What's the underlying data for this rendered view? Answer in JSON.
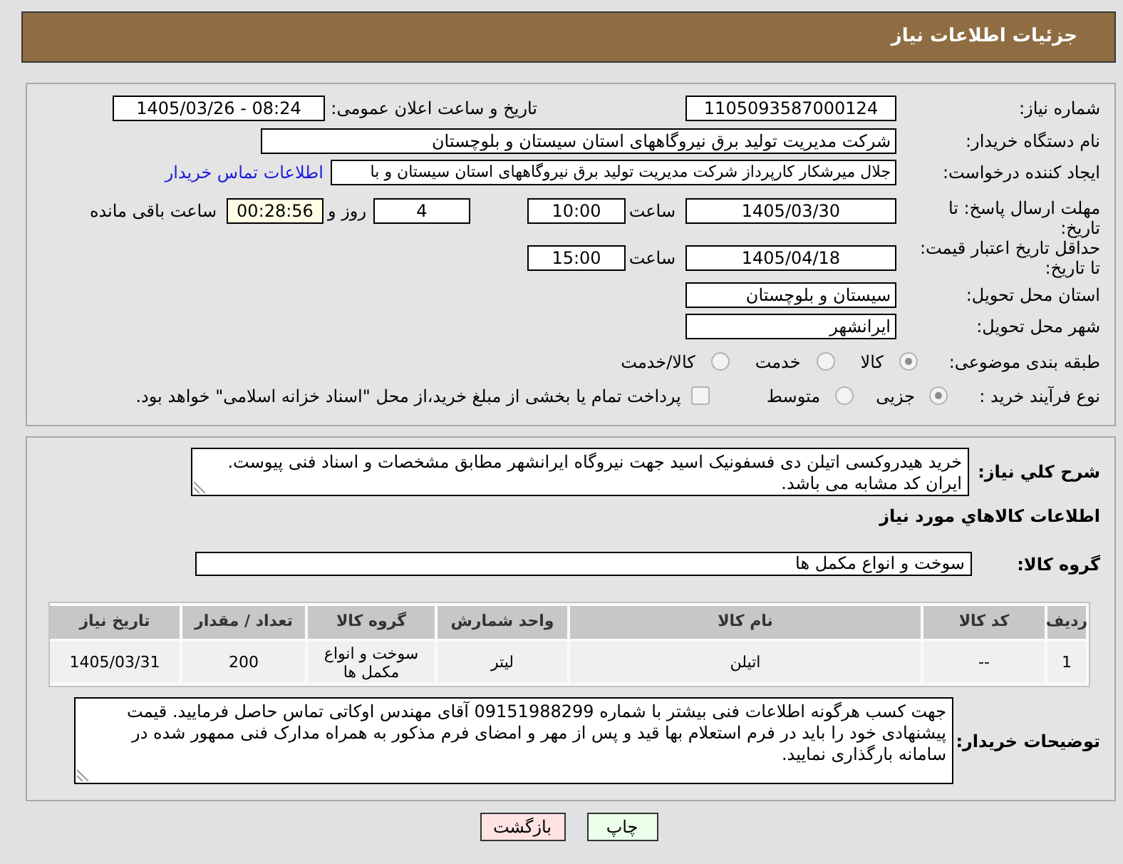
{
  "page": {
    "title": "جزئیات اطلاعات نیاز"
  },
  "details": {
    "need_number": {
      "label": "شماره نیاز:",
      "value": "1105093587000124"
    },
    "announcement": {
      "label": "تاریخ و ساعت اعلان عمومی:",
      "value": "1405/03/26 - 08:24"
    },
    "buyer": {
      "label": "نام دستگاه خریدار:",
      "value": "شرکت مدیریت تولید برق نیروگاههای استان سیستان و بلوچستان"
    },
    "creator": {
      "label": "ایجاد کننده درخواست:",
      "value": "جلال میرشکار کارپرداز شرکت مدیریت تولید برق نیروگاههای استان سیستان و با",
      "contact_link": "اطلاعات تماس خریدار"
    },
    "reply_deadline": {
      "label": "مهلت ارسال پاسخ: تا تاریخ:",
      "date": "1405/03/30",
      "time_label": "ساعت",
      "time": "10:00",
      "days": "4",
      "days_label": "روز و",
      "remaining": "00:28:56",
      "remaining_label": "ساعت باقی مانده"
    },
    "price_validity": {
      "label": "حداقل تاریخ اعتبار قیمت: تا تاریخ:",
      "date": "1405/04/18",
      "time_label": "ساعت",
      "time": "15:00"
    },
    "province": {
      "label": "استان محل تحویل:",
      "value": "سیستان و بلوچستان"
    },
    "city": {
      "label": "شهر محل تحویل:",
      "value": "ایرانشهر"
    },
    "category": {
      "label": "طبقه بندی موضوعی:",
      "options": [
        {
          "label": "کالا",
          "selected": true
        },
        {
          "label": "خدمت",
          "selected": false
        },
        {
          "label": "کالا/خدمت",
          "selected": false
        }
      ]
    },
    "process": {
      "label": "نوع فرآیند خرید :",
      "options": [
        {
          "label": "جزیی",
          "selected": true
        },
        {
          "label": "متوسط",
          "selected": false
        }
      ],
      "treasury": {
        "label": "پرداخت تمام یا بخشی از مبلغ خرید،از محل \"اسناد خزانه اسلامی\" خواهد بود.",
        "checked": false
      }
    }
  },
  "needs": {
    "summary": {
      "label": "شرح کلي نیاز:",
      "value": "خرید هیدروکسی اتیلن دی فسفونیک اسید جهت نیروگاه ایرانشهر مطابق مشخصات و اسناد فنی پیوست. ایران کد مشابه می باشد."
    },
    "goods_heading": "اطلاعات کالاهاي مورد نياز",
    "goods_group": {
      "label": "گروه کالا:",
      "value": "سوخت و انواع مکمل ها"
    },
    "table": {
      "columns": [
        "ردیف",
        "کد کالا",
        "نام کالا",
        "واحد شمارش",
        "گروه کالا",
        "تعداد / مقدار",
        "تاریخ نیاز"
      ],
      "rows": [
        [
          "1",
          "--",
          "اتیلن",
          "لیتر",
          "سوخت و انواع مکمل ها",
          "200",
          "1405/03/31"
        ]
      ]
    },
    "buyer_notes": {
      "label": "توضیحات خریدار:",
      "value": "جهت کسب هرگونه اطلاعات فنی بیشتر با شماره 09151988299 آقای مهندس اوکاتی تماس حاصل فرمایید. قیمت پیشنهادی خود را باید در فرم استعلام بها قید و پس از مهر و امضای فرم مذکور به همراه مدارک فنی ممهور شده در سامانه بارگذاری نمایید."
    }
  },
  "buttons": [
    {
      "label": "چاپ",
      "kind": "print"
    },
    {
      "label": "بازگشت",
      "kind": "back"
    }
  ]
}
